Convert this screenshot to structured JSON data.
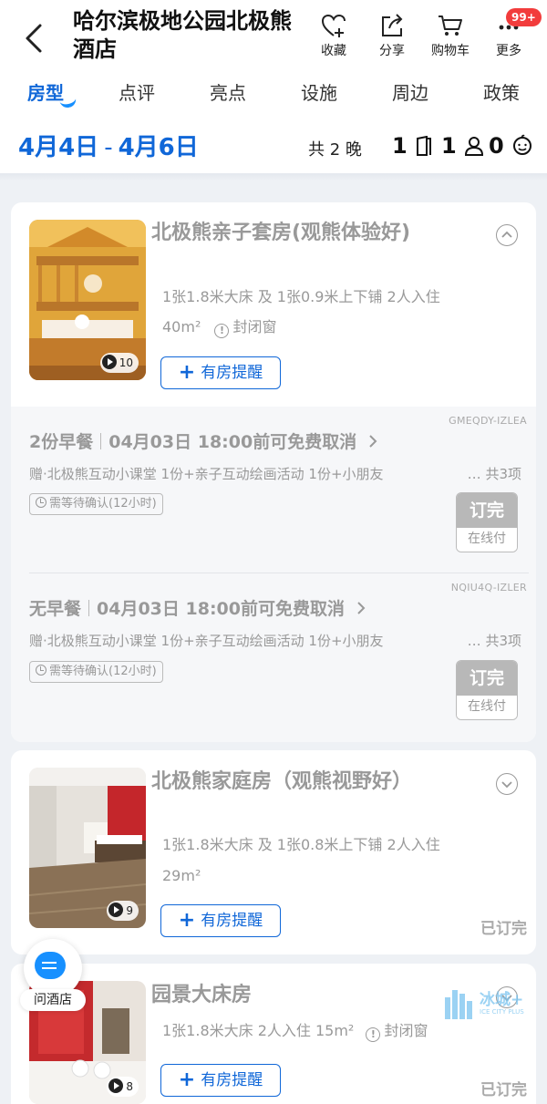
{
  "header": {
    "hotel_name": "哈尔滨极地公园北极熊酒店",
    "actions": [
      {
        "label": "收藏",
        "icon": "heart-plus-icon"
      },
      {
        "label": "分享",
        "icon": "share-icon"
      },
      {
        "label": "购物车",
        "icon": "cart-icon"
      },
      {
        "label": "更多",
        "icon": "more-icon"
      }
    ],
    "more_badge": "99+"
  },
  "tabs": [
    "房型",
    "点评",
    "亮点",
    "设施",
    "周边",
    "政策"
  ],
  "stay": {
    "check_in": "4月4日",
    "dash": "-",
    "check_out": "4月6日",
    "nights": "共 2 晚",
    "rooms": "1",
    "adults": "1",
    "children": "0"
  },
  "rooms": [
    {
      "name": "北极熊亲子套房(观熊体验好)",
      "beds": "1张1.8米大床 及 1张0.9米上下铺  2人入住",
      "area": "40m²",
      "window": "封闭窗",
      "media_count": "10",
      "remind_label": "有房提醒",
      "rates": [
        {
          "code": "GMEQDY-IZLEA",
          "breakfast": "2份早餐",
          "cancel": "04月03日 18:00前可免费取消",
          "gift": "赠·北极熊互动小课堂 1份+亲子互动绘画活动 1份+小朋友",
          "gift_count": "共3项",
          "confirm": "需等待确认(12小时)",
          "book_top": "订完",
          "book_bottom": "在线付"
        },
        {
          "code": "NQIU4Q-IZLER",
          "breakfast": "无早餐",
          "cancel": "04月03日 18:00前可免费取消",
          "gift": "赠·北极熊互动小课堂 1份+亲子互动绘画活动 1份+小朋友",
          "gift_count": "共3项",
          "confirm": "需等待确认(12小时)",
          "book_top": "订完",
          "book_bottom": "在线付"
        }
      ]
    },
    {
      "name": "北极熊家庭房（观熊视野好）",
      "beds": "1张1.8米大床 及 1张0.8米上下铺  2人入住",
      "area": "29m²",
      "media_count": "9",
      "remind_label": "有房提醒",
      "status": "已订完"
    },
    {
      "name": "园景大床房",
      "beds": "1张1.8米大床  2人入住  15m²",
      "window": "封闭窗",
      "media_count": "8",
      "remind_label": "有房提醒",
      "status": "已订完"
    }
  ],
  "floating": {
    "ask_label": "问酒店"
  },
  "watermark": {
    "text": "冰城+",
    "sub": "ICE CITY PLUS"
  },
  "colors": {
    "accent": "#1067d8",
    "badge": "#f23c3c",
    "soldout": "#b8b8b8"
  }
}
